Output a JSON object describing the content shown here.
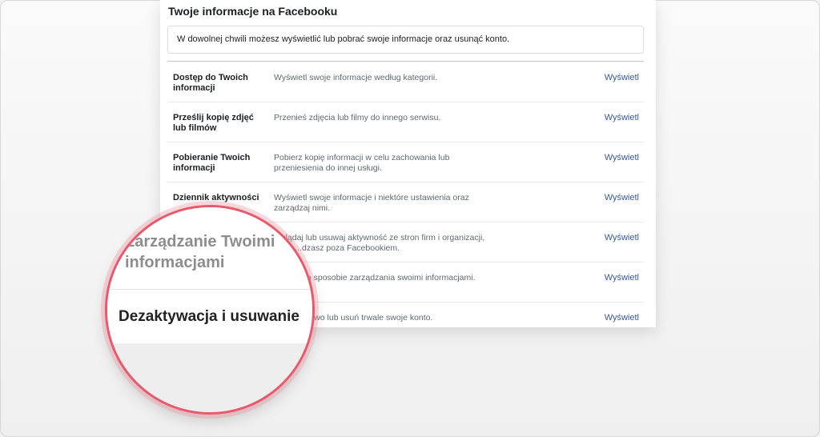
{
  "panel": {
    "title": "Twoje informacje na Facebooku",
    "intro": "W dowolnej chwili możesz wyświetlić lub pobrać swoje informacje oraz usunąć konto."
  },
  "rows": [
    {
      "title": "Dostęp do Twoich informacji",
      "desc": "Wyświetl swoje informacje według kategorii.",
      "link": "Wyświetl"
    },
    {
      "title": "Prześlij kopię zdjęć lub filmów",
      "desc": "Przenieś zdjęcia lub filmy do innego serwisu.",
      "link": "Wyświetl"
    },
    {
      "title": "Pobieranie Twoich informacji",
      "desc": "Pobierz kopię informacji w celu zachowania lub przeniesienia do innej usługi.",
      "link": "Wyświetl"
    },
    {
      "title": "Dziennik aktywności",
      "desc": "Wyświetl swoje informacje i niektóre ustawienia oraz zarządzaj nimi.",
      "link": "Wyświetl"
    },
    {
      "title": "",
      "desc": "...glądaj lub usuwaj aktywność ze stron firm i organizacji, które ...dzasz poza Facebookiem.",
      "link": "Wyświetl"
    },
    {
      "title": "",
      "desc": "...więcej o sposobie zarządzania swoimi informacjami.",
      "link": "Wyświetl"
    },
    {
      "title": "",
      "desc": "...ymczasowo lub usuń trwale swoje konto.",
      "link": "Wyświetl"
    }
  ],
  "magnifier": {
    "faded_label": "Zarządzanie Twoimi informacjami",
    "strong_label": "Dezaktywacja i usuwanie"
  }
}
